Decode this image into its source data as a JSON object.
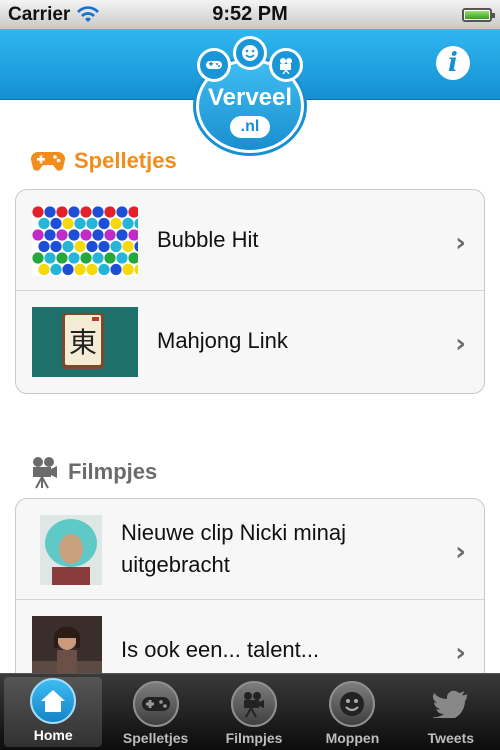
{
  "status_bar": {
    "carrier": "Carrier",
    "time": "9:52 PM"
  },
  "logo": {
    "name": "Verveel",
    "domain": ".nl"
  },
  "colors": {
    "accent": "#1690d2",
    "games_orange": "#f28c1b",
    "video_gray": "#6b6b6b"
  },
  "sections": {
    "games": {
      "title": "Spelletjes",
      "icon": "gamepad-icon",
      "items": [
        {
          "label": "Bubble Hit",
          "thumb": "bubble-hit-thumbnail"
        },
        {
          "label": "Mahjong Link",
          "thumb": "mahjong-link-thumbnail"
        }
      ]
    },
    "videos": {
      "title": "Filmpjes",
      "icon": "film-camera-icon",
      "items": [
        {
          "label": "Nieuwe clip Nicki minaj uitgebracht",
          "thumb": "nicki-minaj-thumbnail"
        },
        {
          "label": "Is ook een... talent...",
          "thumb": "talent-thumbnail"
        }
      ]
    }
  },
  "tabs": [
    {
      "label": "Home",
      "icon": "home-icon",
      "active": true
    },
    {
      "label": "Spelletjes",
      "icon": "gamepad-icon",
      "active": false
    },
    {
      "label": "Filmpjes",
      "icon": "film-camera-icon",
      "active": false
    },
    {
      "label": "Moppen",
      "icon": "smiley-icon",
      "active": false
    },
    {
      "label": "Tweets",
      "icon": "twitter-bird-icon",
      "active": false
    }
  ]
}
